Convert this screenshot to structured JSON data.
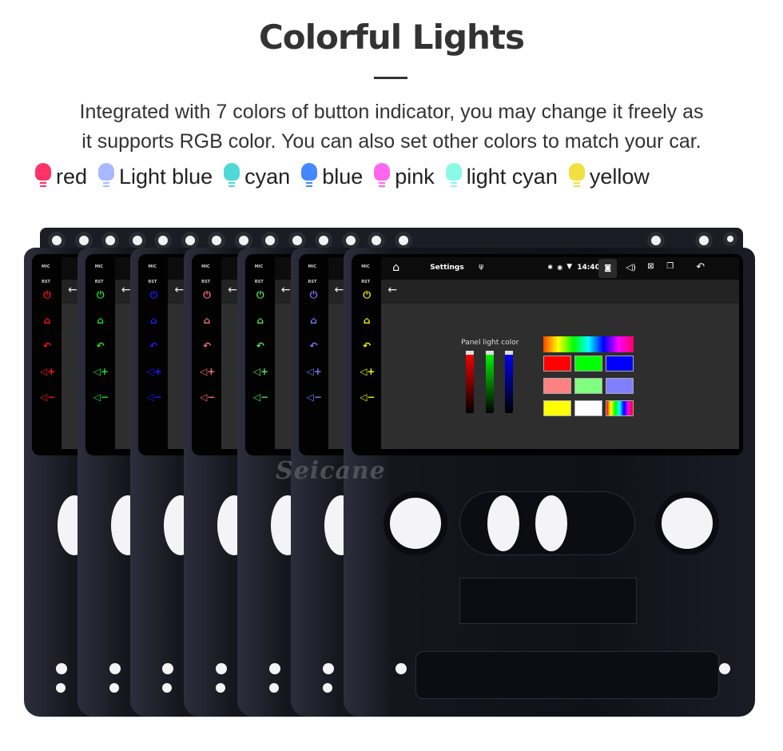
{
  "header": {
    "title": "Colorful Lights",
    "description_lines": [
      "Integrated with 7 colors of button indicator, you may change it freely as",
      "it supports RGB color. You can also set other colors to match your car."
    ]
  },
  "legend": [
    {
      "label": "red",
      "color": "#ff3366"
    },
    {
      "label": "Light blue",
      "color": "#a9b9ff"
    },
    {
      "label": "cyan",
      "color": "#4fd8d8"
    },
    {
      "label": "blue",
      "color": "#4488ff"
    },
    {
      "label": "pink",
      "color": "#ff66ee"
    },
    {
      "label": "light cyan",
      "color": "#88fae6"
    },
    {
      "label": "yellow",
      "color": "#f2e040"
    }
  ],
  "units": {
    "indicator_colors": [
      "#ff1010",
      "#22dd22",
      "#1a1aff",
      "#f07070",
      "#55dd55",
      "#7777ee",
      "#f0f000"
    ],
    "mic_label": "MIC",
    "rst_label": "RST"
  },
  "screen": {
    "app_title": "Settings",
    "time": "14:40",
    "panel_label": "Panel light color",
    "slider_colors": [
      "#ff0000",
      "#00ff00",
      "#0000ff"
    ],
    "swatches": [
      "#ff0000",
      "#00ff00",
      "#0000ff",
      "#ff8080",
      "#80ff80",
      "#8080ff",
      "#ffff00",
      "#ffffff",
      "rainbow"
    ]
  },
  "watermark": "Seicane"
}
